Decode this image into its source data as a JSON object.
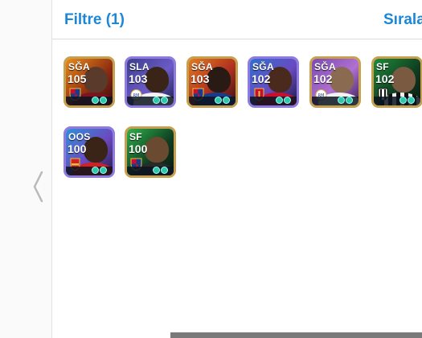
{
  "header": {
    "filter_label": "Filtre (1)",
    "sort_label": "Sırala"
  },
  "icons": {
    "back": "chevron-left-icon"
  },
  "colors": {
    "accent": "#1b87d6"
  },
  "players": [
    {
      "position": "SĞA",
      "rating": "105",
      "club": "barcelona"
    },
    {
      "position": "SLA",
      "rating": "103",
      "club": "real-madrid"
    },
    {
      "position": "SĞA",
      "rating": "103",
      "club": "barcelona"
    },
    {
      "position": "SĞA",
      "rating": "102",
      "club": "liverpool"
    },
    {
      "position": "SĞA",
      "rating": "102",
      "club": "real-madrid"
    },
    {
      "position": "SF",
      "rating": "102",
      "club": "juventus"
    },
    {
      "position": "OOS",
      "rating": "100",
      "club": "arsenal"
    },
    {
      "position": "SF",
      "rating": "100",
      "club": "barcelona"
    }
  ]
}
